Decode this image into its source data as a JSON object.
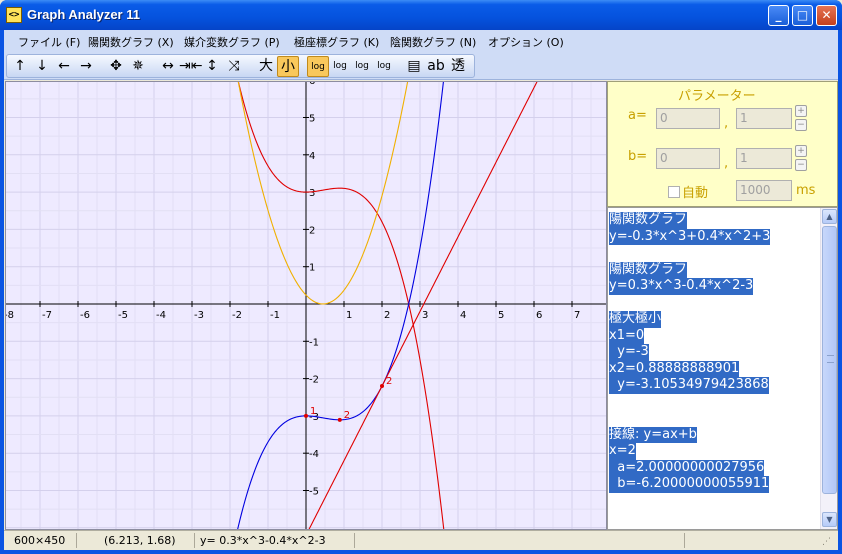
{
  "window": {
    "title": "Graph Analyzer 11",
    "icon_text": "<>",
    "btn_min": "_",
    "btn_max": "□",
    "btn_close": "✕"
  },
  "menu": [
    {
      "label": "ファイル (F)"
    },
    {
      "label": "陽関数グラフ (X)"
    },
    {
      "label": "媒介変数グラフ (P)"
    },
    {
      "label": "極座標グラフ (K)"
    },
    {
      "label": "陰関数グラフ (N)"
    },
    {
      "label": "オプション (O)"
    }
  ],
  "toolbar": {
    "tools": [
      "↑",
      "↓",
      "←",
      "→",
      "✥",
      "✵",
      "↔",
      "⇥⇤",
      "↕",
      "⤨",
      "大",
      "小",
      "log",
      "log",
      "log",
      "log",
      "▤",
      "ab",
      "透"
    ],
    "active": [
      "小",
      "log-1"
    ]
  },
  "params": {
    "title": "パラメーター",
    "a_label": "a=",
    "a_value1": "0",
    "a_sep": ",",
    "a_value2": "1",
    "b_label": "b=",
    "b_value1": "0",
    "b_sep": ",",
    "b_value2": "1",
    "auto_label": "自動",
    "interval_value": "1000",
    "interval_unit": "ms",
    "plus": "+",
    "minus": "−"
  },
  "info_lines": [
    "陽関数グラフ",
    "y=-0.3*x^3+0.4*x^2+3",
    "",
    "陽関数グラフ",
    "y=0.3*x^3-0.4*x^2-3",
    "",
    "極大極小",
    "x1=0",
    "  y=-3",
    "x2=0.88888888901",
    "  y=-3.10534979423868",
    "",
    "",
    "接線: y=ax+b",
    "x=2",
    "  a=2.00000000027956",
    "  b=-6.20000000055911"
  ],
  "status": {
    "size": "600×450",
    "coords": "(6.213, 1.68)",
    "formula": "y= 0.3*x^3-0.4*x^2-3"
  },
  "chart_data": {
    "type": "line",
    "xlim": [
      -8,
      7.8
    ],
    "ylim": [
      -5.8,
      6
    ],
    "x_ticks": [
      -8,
      -7,
      -6,
      -5,
      -4,
      -3,
      -2,
      -1,
      1,
      2,
      3,
      4,
      5,
      6,
      7
    ],
    "y_ticks": [
      6,
      5,
      4,
      3,
      2,
      1,
      -1,
      -2,
      -3,
      -4,
      -5
    ],
    "grid": true,
    "series": [
      {
        "formula": "y=-0.3*x^3+0.4*x^2+3",
        "color": "#e00000",
        "kind": "cubic",
        "coeffs": [
          -0.3,
          0.4,
          0,
          3
        ]
      },
      {
        "formula": "y=0.3*x^3-0.4*x^2-3",
        "color": "#0000e0",
        "kind": "cubic",
        "coeffs": [
          0.3,
          -0.4,
          0,
          -3
        ]
      },
      {
        "color": "#f0b000",
        "kind": "parabola",
        "coeffs": [
          1.2,
          -1.07,
          0.24
        ]
      },
      {
        "formula": "y=ax+b",
        "color": "#e00000",
        "kind": "tangent",
        "a": 2.00000000027956,
        "b": -6.20000000055911
      }
    ],
    "markers": [
      {
        "x": 0,
        "y": -3,
        "label": "1",
        "color": "#e00000"
      },
      {
        "x": 0.8889,
        "y": -3.1053,
        "label": "2",
        "color": "#e00000"
      },
      {
        "x": 2,
        "y": -2.2,
        "label": "2",
        "color": "#e00000"
      }
    ]
  }
}
